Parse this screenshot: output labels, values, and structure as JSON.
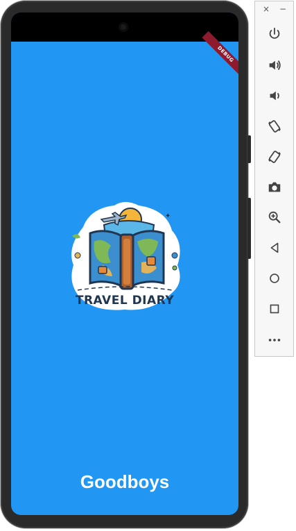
{
  "app": {
    "footer_text": "Goodboys",
    "debug_banner": "DEBUG",
    "logo_text": "TRAVEL DIARY",
    "background_color": "#2196f3"
  },
  "toolbar": {
    "window_controls": [
      {
        "name": "close-icon",
        "glyph": "×"
      },
      {
        "name": "minimize-icon",
        "glyph": "−"
      }
    ],
    "buttons": [
      {
        "name": "power-button",
        "icon": "power-icon"
      },
      {
        "name": "volume-up-button",
        "icon": "volume-up-icon"
      },
      {
        "name": "volume-down-button",
        "icon": "volume-down-icon"
      },
      {
        "name": "rotate-left-button",
        "icon": "rotate-left-icon"
      },
      {
        "name": "rotate-right-button",
        "icon": "rotate-right-icon"
      },
      {
        "name": "screenshot-button",
        "icon": "camera-icon"
      },
      {
        "name": "zoom-button",
        "icon": "zoom-icon"
      },
      {
        "name": "back-button",
        "icon": "back-triangle-icon"
      },
      {
        "name": "home-button",
        "icon": "home-circle-icon"
      },
      {
        "name": "overview-button",
        "icon": "overview-square-icon"
      },
      {
        "name": "more-button",
        "icon": "more-dots-icon"
      }
    ]
  }
}
